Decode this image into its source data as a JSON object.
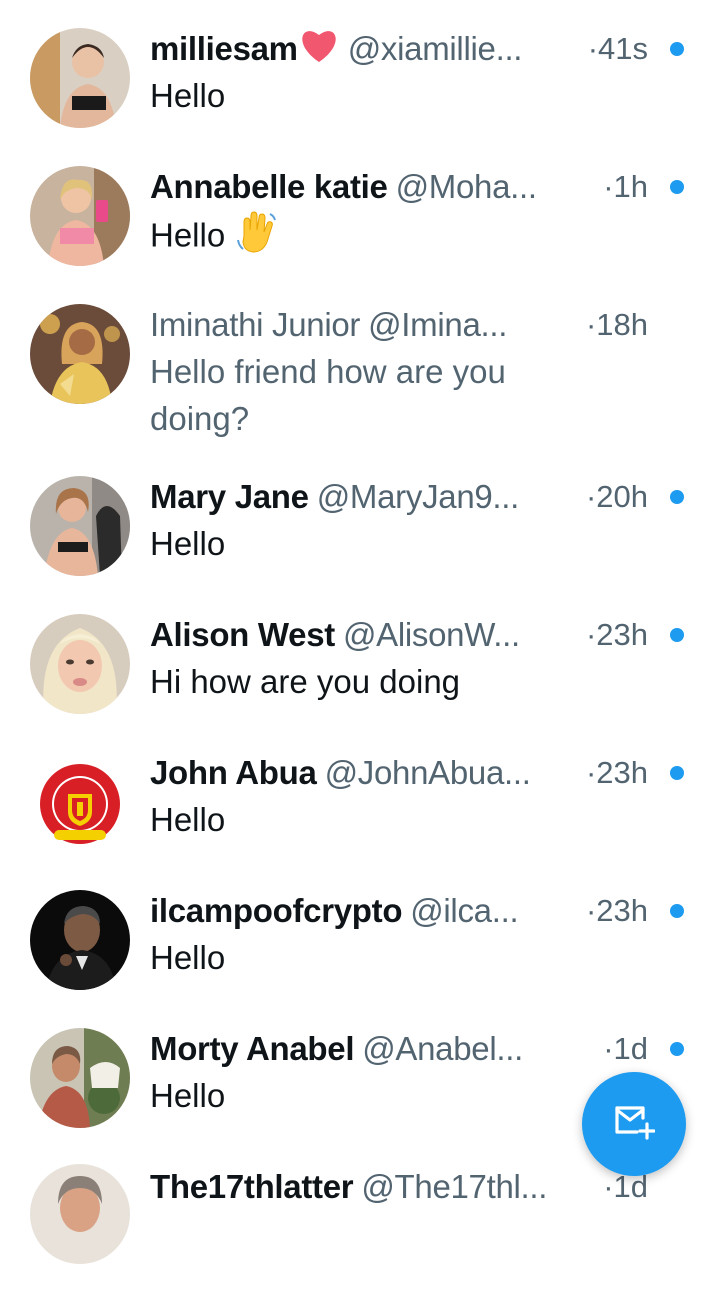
{
  "messages": [
    {
      "name": "milliesam",
      "handle": "@xiamillie...",
      "time": "·41s",
      "preview": "Hello",
      "unread": true,
      "has_heart": true,
      "avatar_icon": "avatar-photo-woman-blonde"
    },
    {
      "name": "Annabelle katie",
      "handle": "@Moha...",
      "time": "·1h",
      "preview": "Hello",
      "unread": true,
      "has_wave": true,
      "avatar_icon": "avatar-photo-woman-pink"
    },
    {
      "name": "Iminathi Junior",
      "handle": "@Imina...",
      "time": "·18h",
      "preview": "Hello friend how are you doing?",
      "unread": false,
      "avatar_icon": "avatar-photo-woman-gold"
    },
    {
      "name": "Mary Jane",
      "handle": "@MaryJan9...",
      "time": "·20h",
      "preview": "Hello",
      "unread": true,
      "avatar_icon": "avatar-photo-woman-mirror"
    },
    {
      "name": "Alison West",
      "handle": "@AlisonW...",
      "time": "·23h",
      "preview": "Hi how are you doing",
      "unread": true,
      "avatar_icon": "avatar-photo-woman-platinum"
    },
    {
      "name": "John Abua",
      "handle": "@JohnAbua...",
      "time": "·23h",
      "preview": "Hello",
      "unread": true,
      "avatar_icon": "avatar-manchester-united-crest"
    },
    {
      "name": "ilcampoofcrypto",
      "handle": "@ilca...",
      "time": "·23h",
      "preview": "Hello",
      "unread": true,
      "avatar_icon": "avatar-photo-man-dark"
    },
    {
      "name": "Morty Anabel",
      "handle": "@Anabel...",
      "time": "·1d",
      "preview": "Hello",
      "unread": true,
      "avatar_icon": "avatar-photo-woman-garden"
    },
    {
      "name": "The17thlatter",
      "handle": "@The17thl...",
      "time": "·1d",
      "preview": "",
      "unread": false,
      "avatar_icon": "avatar-photo-man"
    }
  ],
  "fab": {
    "icon": "new-message-icon"
  },
  "colors": {
    "accent": "#1d9bf0",
    "text_primary": "#0f1419",
    "text_secondary": "#536471",
    "background": "#ffffff"
  }
}
